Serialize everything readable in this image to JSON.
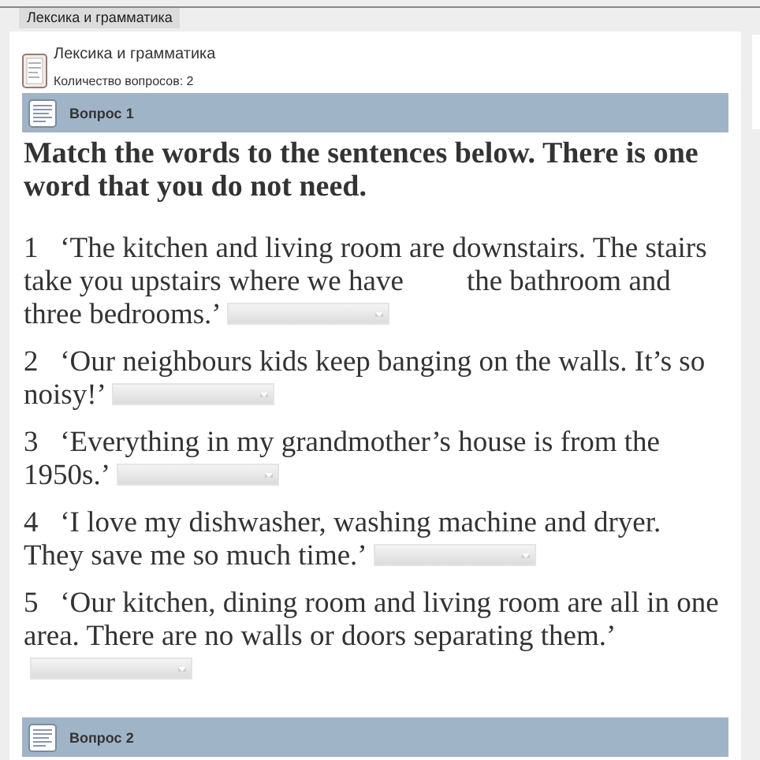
{
  "tab": {
    "label": "Лексика и грамматика"
  },
  "quiz": {
    "title": "Лексика и грамматика",
    "count": "Количество вопросов: 2"
  },
  "questions": [
    {
      "title": "Вопрос 1",
      "instruction": "Match the words to the sentences below. There is one word that you do not need.",
      "items": [
        {
          "number": "1",
          "parts": [
            "‘The kitchen and living room are downstairs. The stairs take you upstairs where we have",
            "the bathroom and three bedrooms.’"
          ]
        },
        {
          "number": "2",
          "parts": [
            "‘Our neighbours kids keep banging on the walls. It’s so noisy!’"
          ]
        },
        {
          "number": "3",
          "parts": [
            "‘Everything in my grandmother’s house is from the 1950s.’"
          ]
        },
        {
          "number": "4",
          "parts": [
            "‘I love my dishwasher, washing machine and dryer. They save me so much time.’"
          ]
        },
        {
          "number": "5",
          "parts": [
            "‘Our kitchen, dining room and living room are all in one area. There are no walls or doors separating them.’"
          ]
        }
      ]
    },
    {
      "title": "Вопрос 2"
    }
  ]
}
